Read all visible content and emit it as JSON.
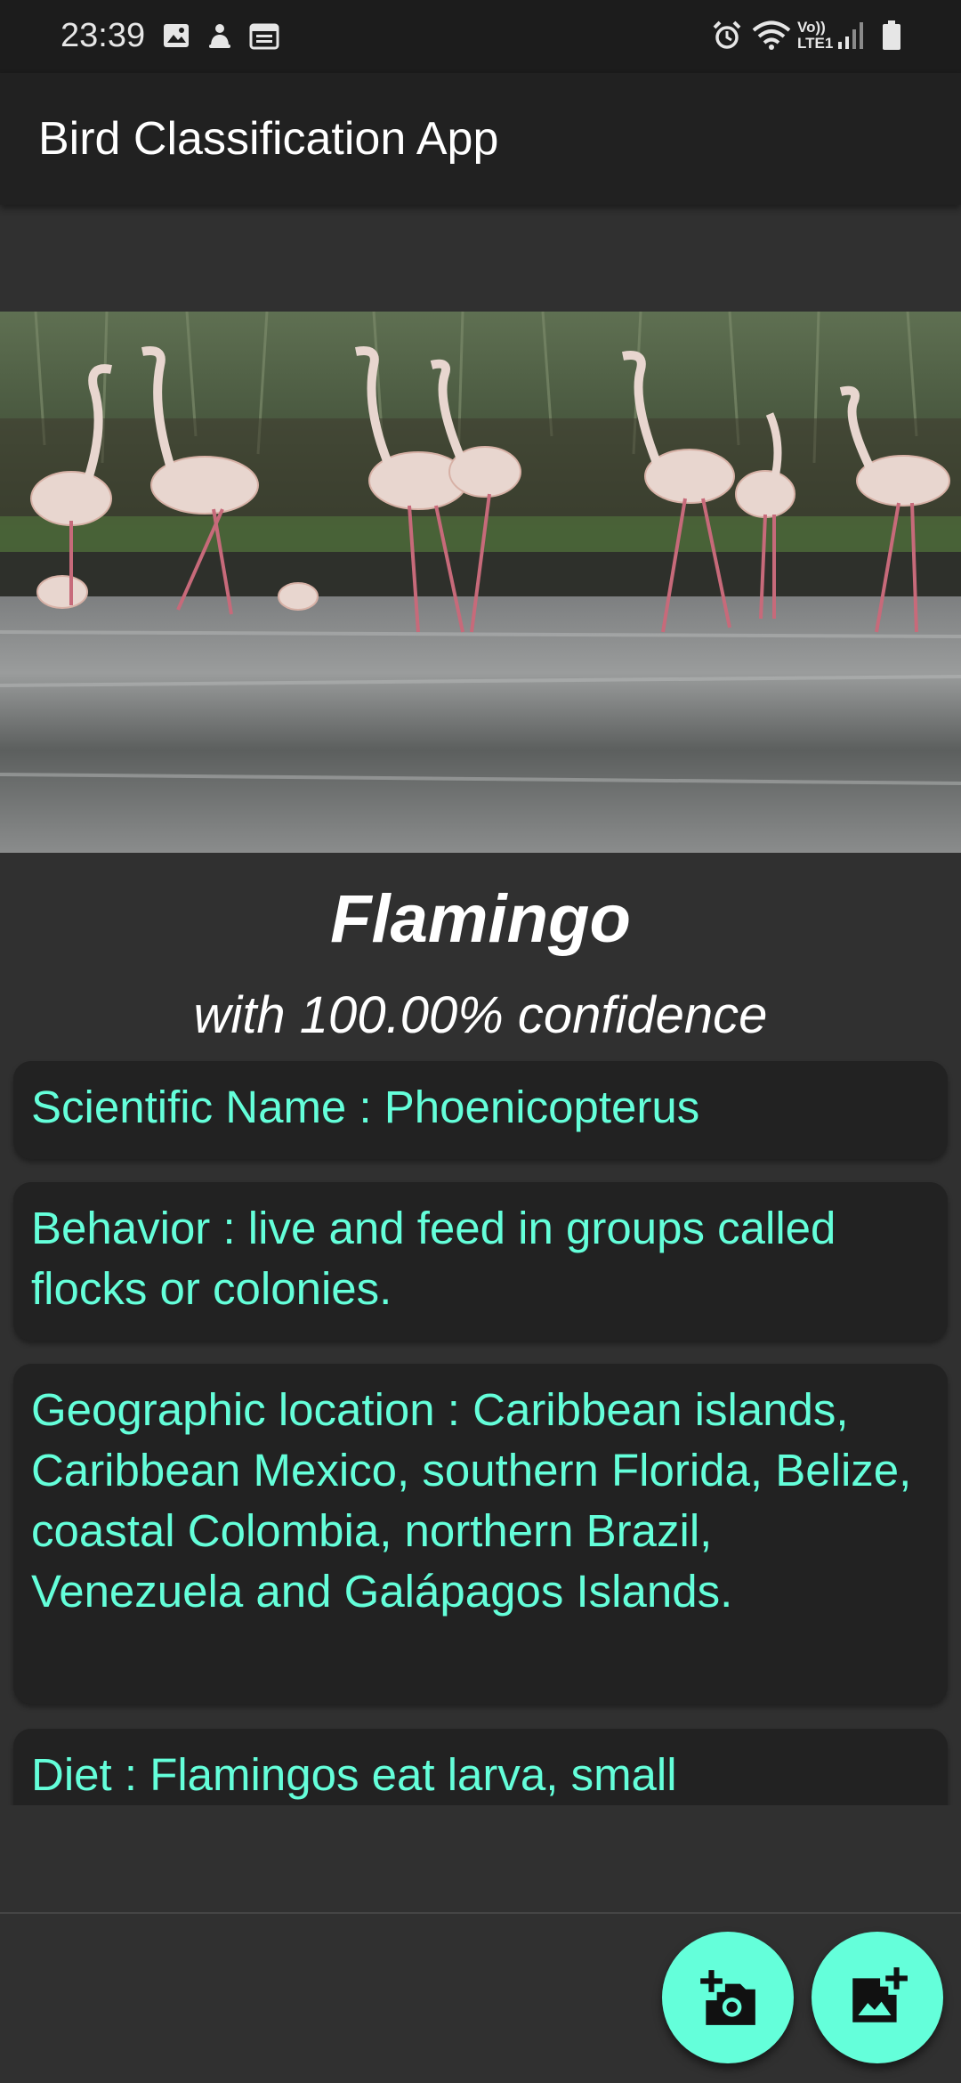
{
  "status_bar": {
    "time": "23:39",
    "left_icons": [
      "image-icon",
      "notification-icon",
      "calendar-icon"
    ],
    "right_icons": [
      "alarm-icon",
      "wifi-icon",
      "volte-icon",
      "signal-icon",
      "battery-icon"
    ],
    "volte_label": "Vo))",
    "lte_label": "LTE1"
  },
  "app_bar": {
    "title": "Bird Classification App"
  },
  "result": {
    "bird_name": "Flamingo",
    "confidence_text": "with 100.00% confidence"
  },
  "cards": [
    {
      "text": "Scientific Name : Phoenicopterus"
    },
    {
      "text": "Behavior : live and feed in groups called flocks or colonies."
    },
    {
      "text": "Geographic location : Caribbean islands, Caribbean Mexico, southern Florida, Belize, coastal Colombia, northern Brazil, Venezuela and Galápagos Islands."
    },
    {
      "text": "Diet : Flamingos eat larva, small"
    }
  ],
  "fabs": {
    "camera": "camera-add-icon",
    "gallery": "gallery-add-icon"
  },
  "colors": {
    "accent": "#64ffda",
    "background": "#303030",
    "app_bar": "#212121",
    "card": "#222222"
  }
}
